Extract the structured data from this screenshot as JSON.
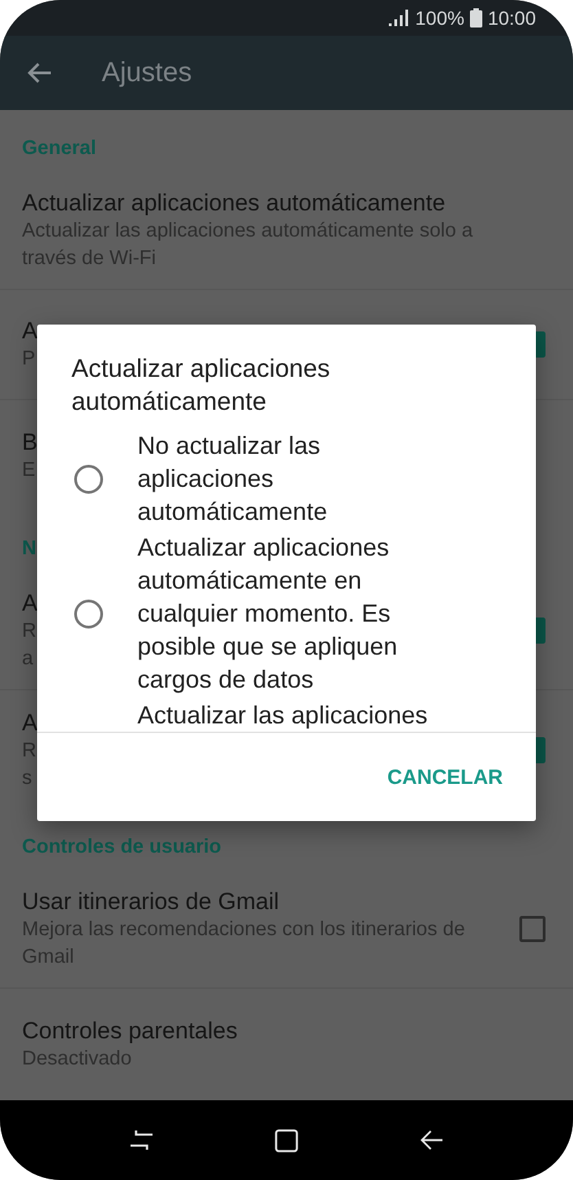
{
  "status_bar": {
    "battery": "100%",
    "time": "10:00"
  },
  "toolbar": {
    "title": "Ajustes"
  },
  "sections": [
    {
      "header": "General",
      "items": [
        {
          "kind": "plain",
          "title": "Actualizar aplicaciones automáticamente",
          "subtitle_lines": [
            "Actualizar las aplicaciones automáticamente solo a través de Wi-Fi"
          ]
        },
        {
          "kind": "checkbox",
          "checked": true,
          "title": "A",
          "subtitle_lines": [
            "P"
          ]
        },
        {
          "kind": "plain",
          "title": "B",
          "subtitle_lines": [
            "E"
          ]
        }
      ]
    },
    {
      "header": "N",
      "items": [
        {
          "kind": "checkbox",
          "checked": true,
          "title": "A",
          "subtitle_lines": [
            "R",
            "a"
          ]
        },
        {
          "kind": "checkbox",
          "checked": true,
          "title": "A",
          "subtitle_lines": [
            "R",
            "s"
          ]
        }
      ]
    },
    {
      "header": "Controles de usuario",
      "items": [
        {
          "kind": "checkbox",
          "checked": false,
          "title": "Usar itinerarios de Gmail",
          "subtitle_lines": [
            "Mejora las recomendaciones con los itinerarios de Gmail"
          ]
        },
        {
          "kind": "plain",
          "title": "Controles parentales",
          "subtitle_lines": [
            "Desactivado"
          ]
        }
      ]
    }
  ],
  "dialog": {
    "title": "Actualizar aplicaciones automáticamente",
    "options": [
      {
        "label": "No actualizar las aplicaciones automáticamente",
        "selected": false
      },
      {
        "label": "Actualizar aplicaciones automáticamente en cualquier momento. Es posible que se apliquen cargos de datos",
        "selected": false
      },
      {
        "label": "Actualizar las aplicaciones"
      }
    ],
    "buttons": [
      "CANCELAR"
    ]
  }
}
